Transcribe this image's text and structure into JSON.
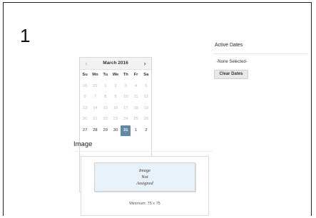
{
  "step": {
    "number": "1"
  },
  "calendar": {
    "prev_label": "‹",
    "next_label": "›",
    "month_title": "March 2016",
    "weekdays": [
      "Su",
      "Mo",
      "Tu",
      "We",
      "Th",
      "Fr",
      "Sa"
    ],
    "weeks": [
      [
        {
          "day": "28",
          "state": "muted"
        },
        {
          "day": "29",
          "state": "muted"
        },
        {
          "day": "1",
          "state": "muted"
        },
        {
          "day": "2",
          "state": "muted"
        },
        {
          "day": "3",
          "state": "muted"
        },
        {
          "day": "4",
          "state": "muted"
        },
        {
          "day": "5",
          "state": "muted"
        }
      ],
      [
        {
          "day": "6",
          "state": "muted"
        },
        {
          "day": "7",
          "state": "muted"
        },
        {
          "day": "8",
          "state": "muted"
        },
        {
          "day": "9",
          "state": "muted"
        },
        {
          "day": "10",
          "state": "muted"
        },
        {
          "day": "11",
          "state": "muted"
        },
        {
          "day": "12",
          "state": "muted"
        }
      ],
      [
        {
          "day": "13",
          "state": "muted"
        },
        {
          "day": "14",
          "state": "muted"
        },
        {
          "day": "15",
          "state": "muted"
        },
        {
          "day": "16",
          "state": "muted"
        },
        {
          "day": "17",
          "state": "muted"
        },
        {
          "day": "18",
          "state": "muted"
        },
        {
          "day": "19",
          "state": "muted"
        }
      ],
      [
        {
          "day": "20",
          "state": "muted"
        },
        {
          "day": "21",
          "state": "muted"
        },
        {
          "day": "22",
          "state": "muted"
        },
        {
          "day": "23",
          "state": "muted"
        },
        {
          "day": "24",
          "state": "muted"
        },
        {
          "day": "25",
          "state": "muted"
        },
        {
          "day": "26",
          "state": "muted"
        }
      ],
      [
        {
          "day": "27",
          "state": "current"
        },
        {
          "day": "28",
          "state": "current"
        },
        {
          "day": "29",
          "state": "current"
        },
        {
          "day": "30",
          "state": "current"
        },
        {
          "day": "31",
          "state": "today"
        },
        {
          "day": "1",
          "state": "current"
        },
        {
          "day": "2",
          "state": "current"
        }
      ]
    ],
    "today_color": "#5f8aa6"
  },
  "active_dates": {
    "title": "Active Dates",
    "none_selected": "-None Selected-",
    "clear_button": "Clear Dates"
  },
  "image_section": {
    "heading": "Image",
    "placeholder_lines": [
      "Image",
      "Not",
      "Assigned"
    ],
    "minimum_note": "Minimum: 75 x 75"
  }
}
